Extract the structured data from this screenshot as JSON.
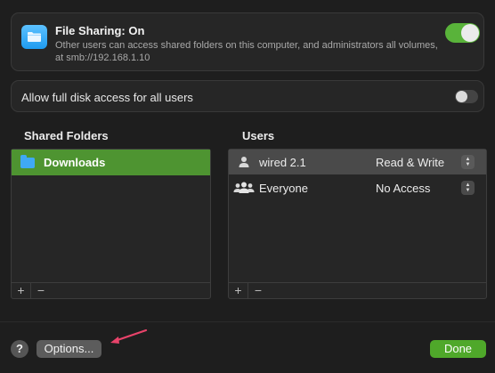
{
  "file_sharing": {
    "title": "File Sharing: On",
    "description": "Other users can access shared folders on this computer, and administrators all volumes, at smb://192.168.1.10",
    "enabled": true,
    "icon": "folder-icon"
  },
  "full_disk_access": {
    "label": "Allow full disk access for all users",
    "enabled": false
  },
  "shared_folders": {
    "heading": "Shared Folders",
    "items": [
      {
        "label": "Downloads",
        "selected": true,
        "icon": "folder-icon"
      }
    ],
    "add_label": "+",
    "remove_label": "−"
  },
  "users": {
    "heading": "Users",
    "rows": [
      {
        "name": "wired 2.1",
        "permission": "Read & Write",
        "icon": "person-icon",
        "selected": true
      },
      {
        "name": "Everyone",
        "permission": "No Access",
        "icon": "group-icon",
        "selected": false
      }
    ],
    "add_label": "+",
    "remove_label": "−"
  },
  "footer": {
    "help_label": "?",
    "options_label": "Options...",
    "done_label": "Done"
  },
  "colors": {
    "accent_green": "#4fa82a",
    "selection_green": "#4e9431",
    "annotation_arrow": "#e8436a"
  }
}
